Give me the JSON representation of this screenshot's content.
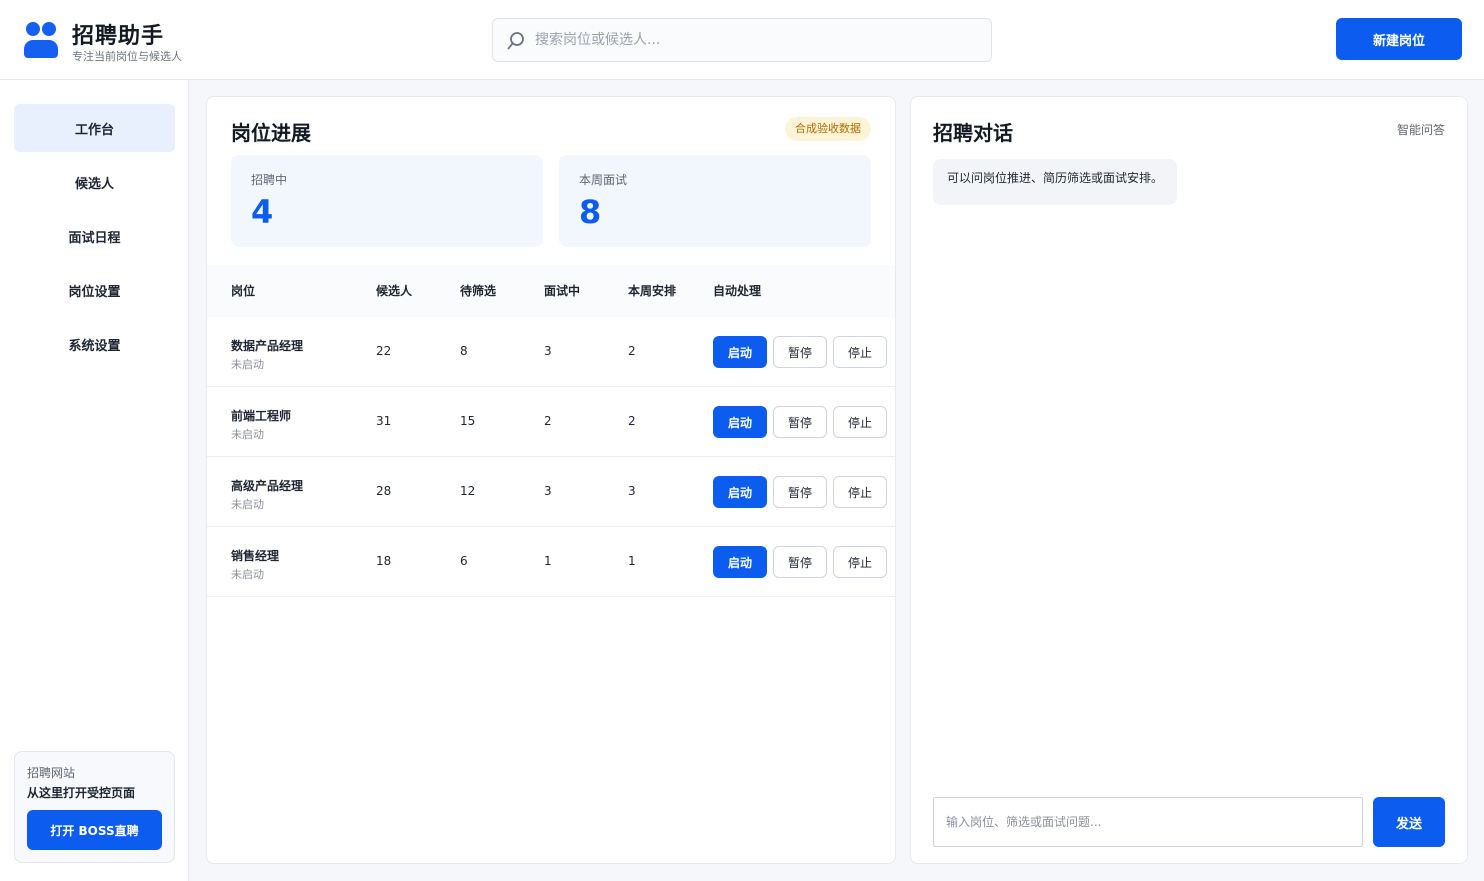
{
  "brand": {
    "title": "招聘助手",
    "subtitle": "专注当前岗位与候选人"
  },
  "search": {
    "placeholder": "搜索岗位或候选人..."
  },
  "header": {
    "new_job_label": "新建岗位"
  },
  "sidebar": {
    "items": [
      {
        "label": "工作台",
        "active": true
      },
      {
        "label": "候选人"
      },
      {
        "label": "面试日程"
      },
      {
        "label": "岗位设置"
      },
      {
        "label": "系统设置"
      }
    ],
    "site_card": {
      "label": "招聘网站",
      "desc": "从这里打开受控页面",
      "button": "打开 BOSS直聘"
    }
  },
  "main": {
    "title": "岗位进展",
    "badge": "合成验收数据",
    "stats": [
      {
        "label": "招聘中",
        "value": "4"
      },
      {
        "label": "本周面试",
        "value": "8"
      }
    ],
    "columns": [
      "岗位",
      "候选人",
      "待筛选",
      "面试中",
      "本周安排",
      "自动处理"
    ],
    "actions": {
      "start": "启动",
      "pause": "暂停",
      "stop": "停止"
    },
    "rows": [
      {
        "name": "数据产品经理",
        "status": "未启动",
        "candidates": "22",
        "pending": "8",
        "interviewing": "3",
        "this_week": "2"
      },
      {
        "name": "前端工程师",
        "status": "未启动",
        "candidates": "31",
        "pending": "15",
        "interviewing": "2",
        "this_week": "2"
      },
      {
        "name": "高级产品经理",
        "status": "未启动",
        "candidates": "28",
        "pending": "12",
        "interviewing": "3",
        "this_week": "3"
      },
      {
        "name": "销售经理",
        "status": "未启动",
        "candidates": "18",
        "pending": "6",
        "interviewing": "1",
        "this_week": "1"
      }
    ]
  },
  "chat": {
    "title": "招聘对话",
    "mode": "智能问答",
    "message": "可以问岗位推进、简历筛选或面试安排。",
    "input_placeholder": "输入岗位、筛选或面试问题...",
    "send_label": "发送"
  },
  "colors": {
    "accent": "#0d5cf0",
    "badge_bg": "#fdf3d6",
    "badge_text": "#b06d00",
    "active_nav": "#e9f0fd"
  }
}
